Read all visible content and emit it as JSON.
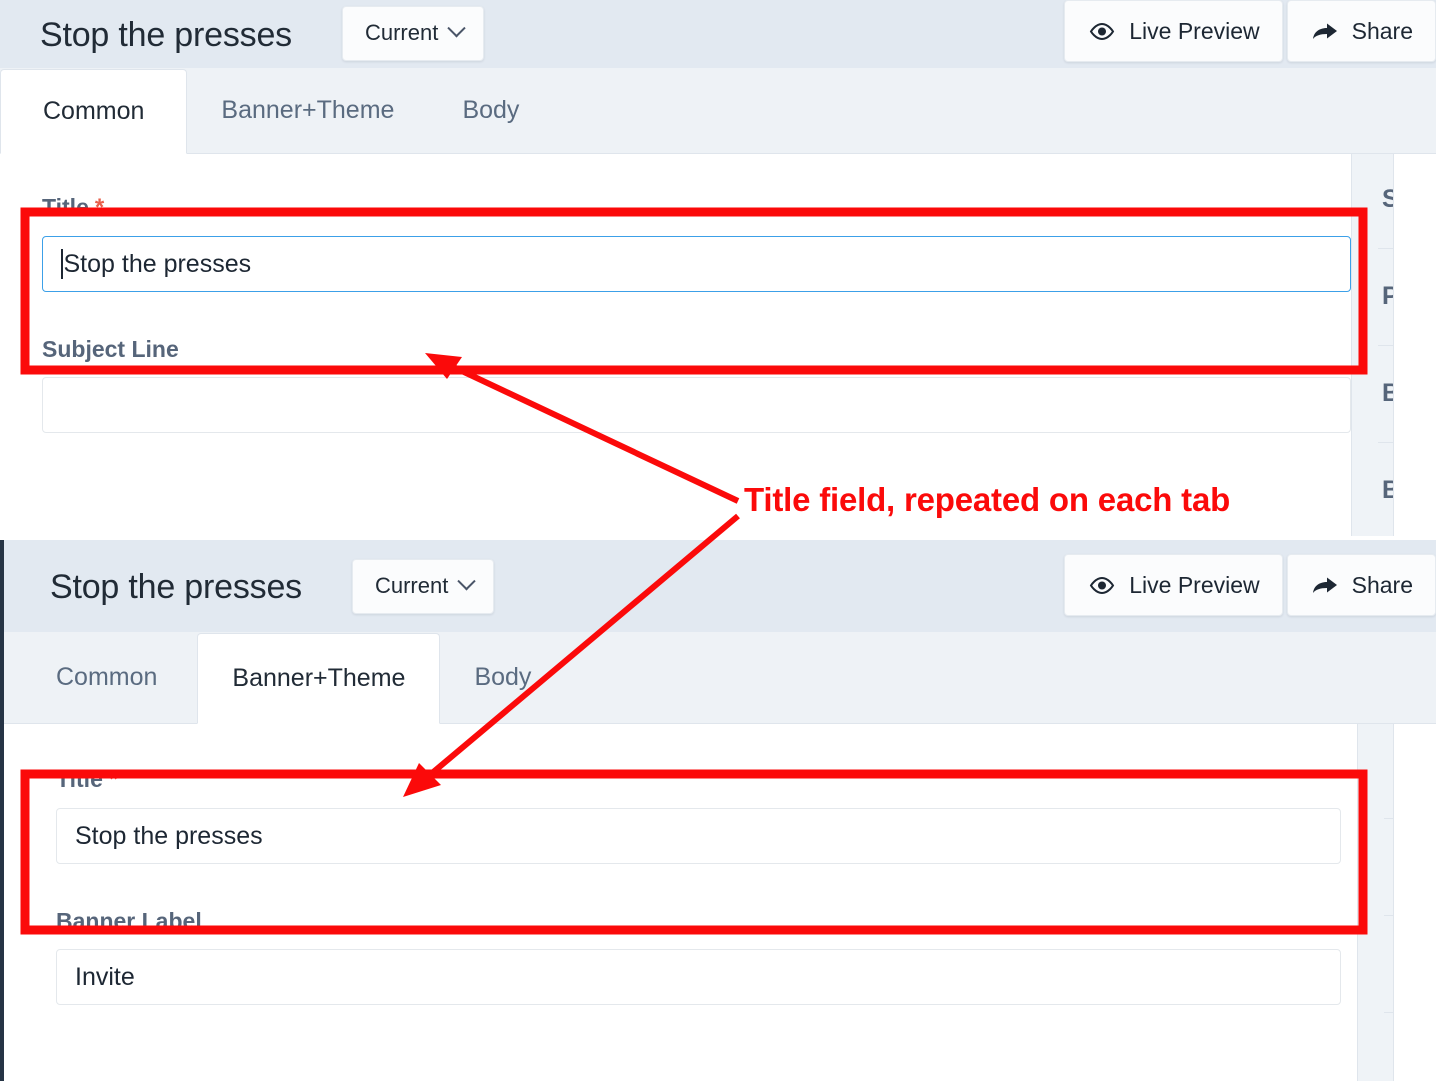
{
  "annotation": {
    "text": "Title field, repeated on each tab",
    "color": "#fb0a0a"
  },
  "panels": [
    {
      "id": "panel-common",
      "header": {
        "title": "Stop the presses",
        "version_button": {
          "label": "Current",
          "icon": "chevron-down-icon"
        },
        "actions": [
          {
            "label": "Live Preview",
            "icon": "eye-icon"
          },
          {
            "label": "Share",
            "icon": "share-arrow-icon"
          }
        ]
      },
      "tabs": [
        {
          "label": "Common",
          "active": true
        },
        {
          "label": "Banner+Theme",
          "active": false
        },
        {
          "label": "Body",
          "active": false
        }
      ],
      "fields": [
        {
          "label": "Title",
          "required": true,
          "required_marker": "*",
          "value": "Stop the presses",
          "placeholder": "",
          "focused": true,
          "highlighted": true
        },
        {
          "label": "Subject Line",
          "required": false,
          "required_marker": "",
          "value": "",
          "placeholder": "",
          "focused": false,
          "highlighted": false
        }
      ],
      "right_rail": [
        "S",
        "P",
        "B",
        "B"
      ]
    },
    {
      "id": "panel-banner-theme",
      "header": {
        "title": "Stop the presses",
        "version_button": {
          "label": "Current",
          "icon": "chevron-down-icon"
        },
        "actions": [
          {
            "label": "Live Preview",
            "icon": "eye-icon"
          },
          {
            "label": "Share",
            "icon": "share-arrow-icon"
          }
        ]
      },
      "tabs": [
        {
          "label": "Common",
          "active": false
        },
        {
          "label": "Banner+Theme",
          "active": true
        },
        {
          "label": "Body",
          "active": false
        }
      ],
      "fields": [
        {
          "label": "Title",
          "required": true,
          "required_marker": "*",
          "value": "Stop the presses",
          "placeholder": "",
          "focused": false,
          "highlighted": true
        },
        {
          "label": "Banner Label",
          "required": false,
          "required_marker": "",
          "value": "Invite",
          "placeholder": "",
          "focused": false,
          "highlighted": false
        }
      ],
      "right_rail": [
        "",
        "",
        "",
        ""
      ]
    }
  ],
  "colors": {
    "header_bg": "#e2e9f1",
    "tabstrip_bg": "#eef2f6",
    "label": "#56657a",
    "required": "#e8604c",
    "focus_border": "#3ca0e8",
    "annotation": "#fb0a0a",
    "panel_edge": "#263445"
  }
}
